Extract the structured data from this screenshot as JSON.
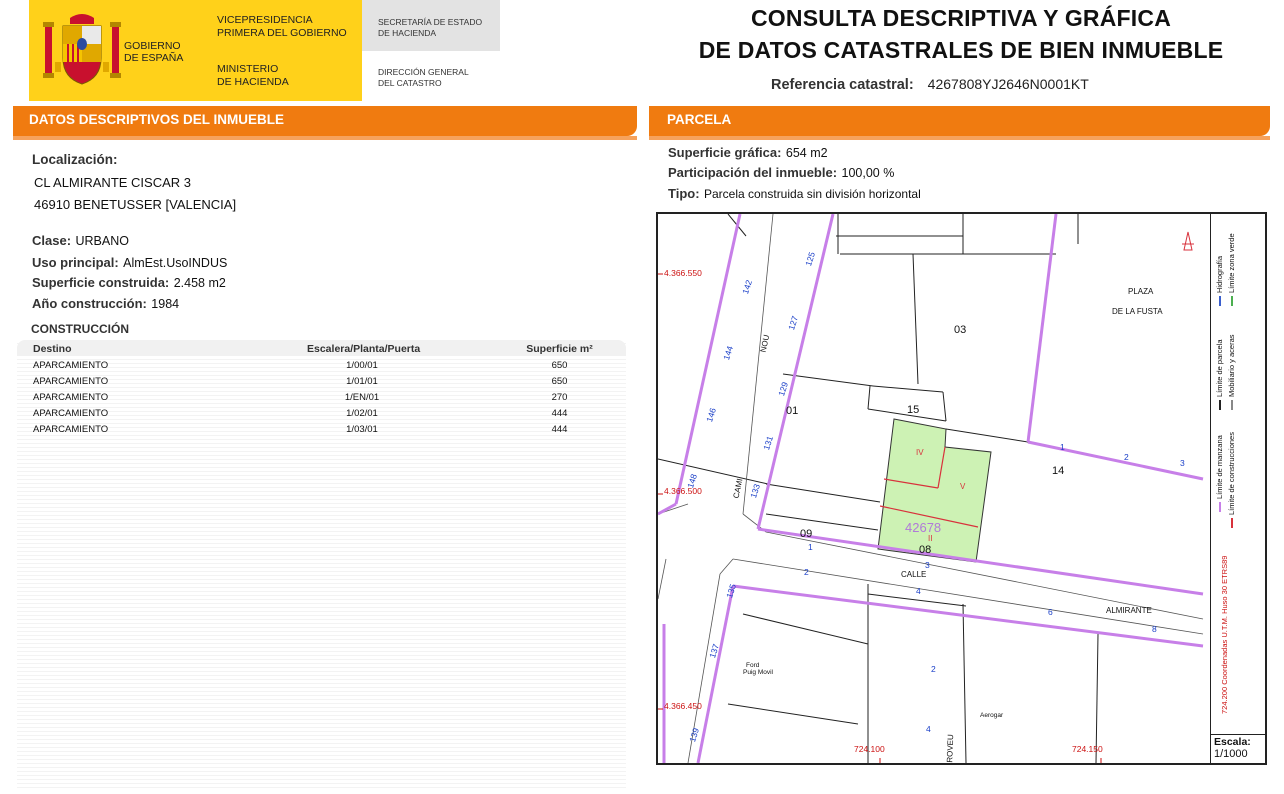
{
  "header": {
    "gov_line1": "GOBIERNO",
    "gov_line2": "DE ESPAÑA",
    "vice_line1": "VICEPRESIDENCIA",
    "vice_line2": "PRIMERA DEL GOBIERNO",
    "min_line1": "MINISTERIO",
    "min_line2": "DE HACIENDA",
    "sec_line1": "SECRETARÍA DE ESTADO",
    "sec_line2": "DE HACIENDA",
    "dir_line1": "DIRECCIÓN GENERAL",
    "dir_line2": "DEL CATASTRO",
    "title_line1": "CONSULTA DESCRIPTIVA Y GRÁFICA",
    "title_line2": "DE DATOS CATASTRALES DE BIEN INMUEBLE",
    "ref_label": "Referencia catastral:",
    "ref_value": "4267808YJ2646N0001KT"
  },
  "left": {
    "section_title": "DATOS DESCRIPTIVOS DEL INMUEBLE",
    "localizacion_label": "Localización:",
    "address_line1": "CL ALMIRANTE CISCAR 3",
    "address_line2": "46910 BENETUSSER [VALENCIA]",
    "clase_label": "Clase:",
    "clase_value": "URBANO",
    "uso_label": "Uso principal:",
    "uso_value": "AlmEst.UsoINDUS",
    "sup_label": "Superficie construida:",
    "sup_value": "2.458 m2",
    "anio_label": "Año construcción:",
    "anio_value": "1984",
    "construccion_title": "CONSTRUCCIÓN",
    "table": {
      "headers": [
        "Destino",
        "Escalera/Planta/Puerta",
        "Superficie m²"
      ],
      "rows": [
        [
          "APARCAMIENTO",
          "1/00/01",
          "650"
        ],
        [
          "APARCAMIENTO",
          "1/01/01",
          "650"
        ],
        [
          "APARCAMIENTO",
          "1/EN/01",
          "270"
        ],
        [
          "APARCAMIENTO",
          "1/02/01",
          "444"
        ],
        [
          "APARCAMIENTO",
          "1/03/01",
          "444"
        ]
      ]
    }
  },
  "right": {
    "section_title": "PARCELA",
    "sup_grafica_label": "Superficie gráfica:",
    "sup_grafica_value": "654 m2",
    "participacion_label": "Participación del inmueble:",
    "participacion_value": "100,00 %",
    "tipo_label": "Tipo:",
    "tipo_value": "Parcela construida sin división horizontal"
  },
  "map": {
    "colors": {
      "manzana": "#c77fe8",
      "parcel_fill": "#cdf2b4",
      "constr": "#d8323c",
      "number": "#1a3fc8"
    },
    "coord_y_top": "4.366.550",
    "coord_y_mid": "4.366.500",
    "coord_y_bot": "4.366.450",
    "coord_x_left": "724.100",
    "coord_x_right": "724.150",
    "parcel_ref": "42678",
    "place_line1": "PLAZA",
    "place_line2": "DE LA FUSTA",
    "street_calle": "CALLE",
    "street_almirante": "ALMIRANTE",
    "street_camí": "CAMI",
    "street_nou": "NOU",
    "street_roveu": "ROVEU",
    "business_ford_1": "Ford",
    "business_ford_2": "Puig Movil",
    "business_aerogar": "Aerogar",
    "lot_03": "03",
    "lot_01": "01",
    "lot_15": "15",
    "lot_14": "14",
    "lot_09": "09",
    "lot_08": "08",
    "roman_iv": "IV",
    "roman_v": "V",
    "roman_ii": "II",
    "portal_numbers": [
      "142",
      "125",
      "144",
      "127",
      "146",
      "129",
      "131",
      "148",
      "133",
      "135",
      "137",
      "139",
      "1",
      "2",
      "3",
      "1",
      "2",
      "3",
      "4",
      "6",
      "8",
      "2",
      "4"
    ],
    "legend_manzana": "Límite de manzana",
    "legend_parcela": "Límite de parcela",
    "legend_hidro": "Hidrografía",
    "legend_constr": "Límite de construcciones",
    "legend_mobil": "Mobiliario y aceras",
    "legend_verde": "Límite zona verde",
    "legend_coord": "Coordenadas U.T.M. Huso 30 ETRS89",
    "legend_coord_x": "724.200",
    "scale_label": "Escala:",
    "scale_value": "1/1000"
  }
}
